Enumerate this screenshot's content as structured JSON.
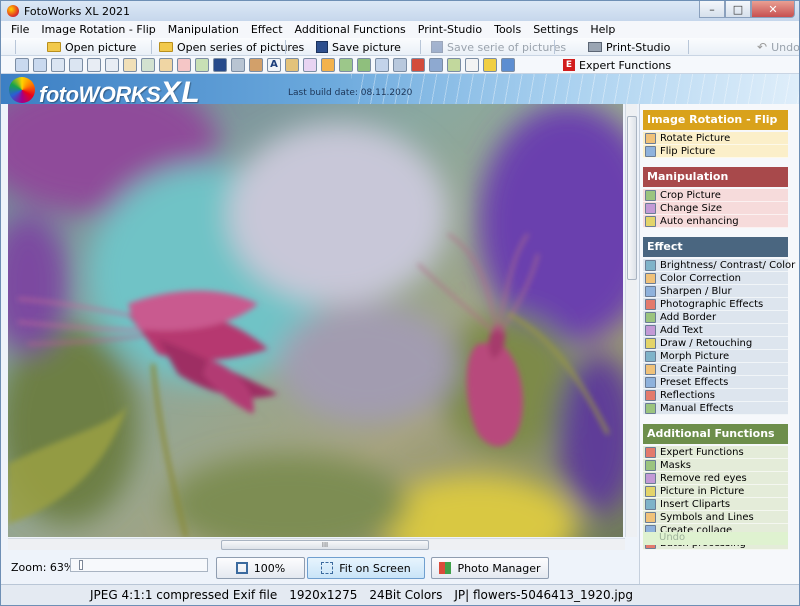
{
  "window": {
    "title": "FotoWorks XL 2021"
  },
  "menu": [
    "File",
    "Image Rotation - Flip",
    "Manipulation",
    "Effect",
    "Additional Functions",
    "Print-Studio",
    "Tools",
    "Settings",
    "Help"
  ],
  "toolbar": {
    "open_picture": "Open picture",
    "open_series": "Open series of pictures",
    "save_picture": "Save picture",
    "save_series": "Save serie of pictures",
    "print_studio": "Print-Studio",
    "undo": "Undo",
    "expert_functions": "Expert Functions"
  },
  "banner": {
    "logo_text": "foto",
    "logo_bold": "WORKS",
    "logo_xl": "XL",
    "build_date": "Last build date: 08.11.2020"
  },
  "viewer": {
    "scroll_grip": "III"
  },
  "zoom": {
    "label": "Zoom: 63%",
    "btn_100": "100%",
    "btn_fit": "Fit on Screen",
    "btn_photo_manager": "Photo Manager"
  },
  "status": {
    "format": "JPEG 4:1:1 compressed Exif file",
    "dimensions": "1920x1275",
    "colors": "24Bit Colors",
    "filename": "JP| flowers-5046413_1920.jpg"
  },
  "panel": {
    "sections": [
      {
        "title": "Image Rotation - Flip",
        "color": "#d9a21b",
        "item_bg": "#fbefc9",
        "items": [
          "Rotate Picture",
          "Flip Picture"
        ]
      },
      {
        "title": "Manipulation",
        "color": "#a8494b",
        "item_bg": "#f6dbdb",
        "items": [
          "Crop Picture",
          "Change Size",
          "Auto enhancing"
        ]
      },
      {
        "title": "Effect",
        "color": "#4a6680",
        "item_bg": "#dde5ee",
        "items": [
          "Brightness/ Contrast/ Color",
          "Color Correction",
          "Sharpen / Blur",
          "Photographic Effects",
          "Add Border",
          "Add Text",
          "Draw / Retouching",
          "Morph Picture",
          "Create Painting",
          "Preset Effects",
          "Reflections",
          "Manual Effects"
        ]
      },
      {
        "title": "Additional Functions",
        "color": "#6d8e4b",
        "item_bg": "#e4ecd9",
        "items": [
          "Expert Functions",
          "Masks",
          "Remove red eyes",
          "Picture in Picture",
          "Insert Cliparts",
          "Symbols and Lines",
          "Create collage",
          "Batch processing"
        ]
      }
    ],
    "undo_label": "Undo"
  }
}
